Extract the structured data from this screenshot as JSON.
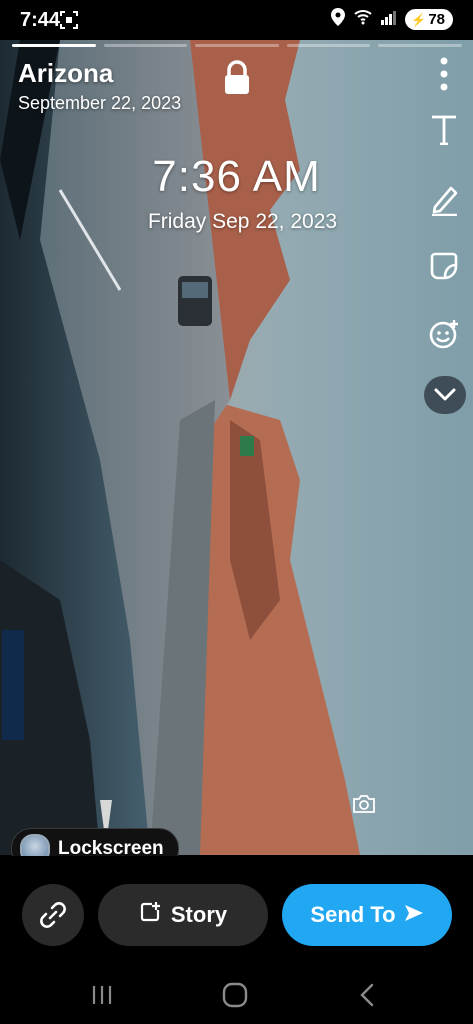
{
  "status_bar": {
    "time": "7:44",
    "battery": "78",
    "icons": [
      "screenshot-icon",
      "location-icon",
      "wifi-icon",
      "signal-icon",
      "battery-icon"
    ]
  },
  "story_header": {
    "location": "Arizona",
    "date": "September 22, 2023"
  },
  "time_sticker": {
    "time": "7:36 AM",
    "date": "Friday Sep 22, 2023"
  },
  "toolbar": {
    "tools": [
      "more-options-icon",
      "text-icon",
      "pencil-icon",
      "sticker-icon",
      "emoji-add-icon",
      "chevron-down-icon"
    ]
  },
  "lockscreen_chip": {
    "label": "Lockscreen"
  },
  "actions": {
    "story_label": "Story",
    "send_label": "Send To"
  },
  "colors": {
    "send_button": "#22a7f2",
    "dark_button": "#2b2b2b",
    "sky": "#8fa8b0",
    "cliffs": "#b06a4e"
  }
}
